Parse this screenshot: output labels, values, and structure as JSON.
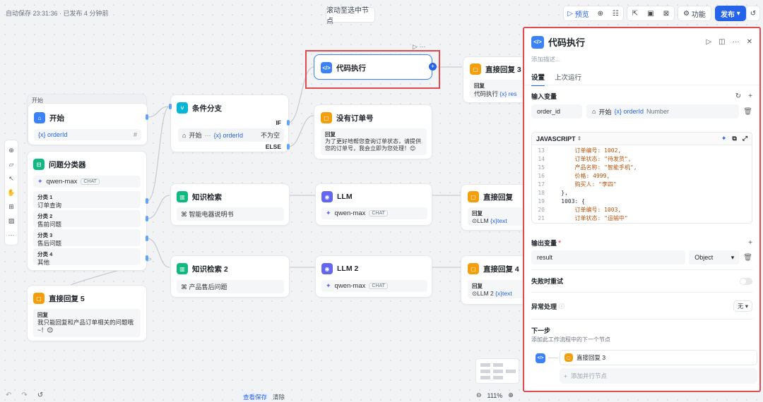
{
  "topbar": {
    "autosave": "自动保存 23:31:36 · 已发布 4 分钟前",
    "scroll_btn": "滚动至选中节点",
    "preview": "预览",
    "features": "功能",
    "publish": "发布"
  },
  "nodes": {
    "start": {
      "group_label": "开始",
      "title": "开始",
      "var": "{x} orderId",
      "hash": "#"
    },
    "classifier": {
      "title": "问题分类器",
      "model": "qwen-max",
      "tag": "CHAT",
      "classes": [
        {
          "label": "分类 1",
          "text": "订单查询"
        },
        {
          "label": "分类 2",
          "text": "售前问题"
        },
        {
          "label": "分类 3",
          "text": "售后问题"
        },
        {
          "label": "分类 4",
          "text": "其他"
        }
      ]
    },
    "reply5": {
      "title": "直接回复 5",
      "label": "回复",
      "text": "我只能回复和产品订单相关的问题哦~！😊"
    },
    "condition": {
      "title": "条件分支",
      "if": "IF",
      "else": "ELSE",
      "start_ref": "开始",
      "dots": "···",
      "var": "{x} orderId",
      "op": "不为空"
    },
    "code": {
      "title": "代码执行"
    },
    "no_order": {
      "title": "没有订单号",
      "label": "回复",
      "text": "为了更好地帮您查询订单状态，请提供您的订单号，我会立即为您处理！😊"
    },
    "reply3": {
      "title": "直接回复 3",
      "label": "回复",
      "ref": "代码执行",
      "var": "{x} res"
    },
    "kb1": {
      "title": "知识检索",
      "item": "智能电器说明书"
    },
    "llm": {
      "title": "LLM",
      "model": "qwen-max",
      "tag": "CHAT"
    },
    "reply_llm": {
      "title": "直接回复",
      "label": "回复",
      "ref": "LLM",
      "var": "{x}text"
    },
    "kb2": {
      "title": "知识检索 2",
      "item": "产品售后问题"
    },
    "llm2": {
      "title": "LLM 2",
      "model": "qwen-max",
      "tag": "CHAT"
    },
    "reply4": {
      "title": "直接回复 4",
      "label": "回复",
      "ref": "LLM 2",
      "var": "{x}text"
    }
  },
  "panel": {
    "title": "代码执行",
    "desc_placeholder": "添加描述...",
    "tabs": [
      "设置",
      "上次运行"
    ],
    "input_vars_label": "输入变量",
    "input_var_name": "order_id",
    "input_var_src": "开始",
    "input_var_ref": "{x} orderId",
    "input_var_type": "Number",
    "lang": "JAVASCRIPT",
    "code_lines": [
      {
        "n": "13",
        "t": "        订单编号: 1002,"
      },
      {
        "n": "14",
        "t": "        订单状态: \"待发货\","
      },
      {
        "n": "15",
        "t": "        产品名称: \"智能手机\","
      },
      {
        "n": "16",
        "t": "        价格: 4999,"
      },
      {
        "n": "17",
        "t": "        购买人: \"李四\""
      },
      {
        "n": "18",
        "t": "    },"
      },
      {
        "n": "19",
        "t": "    1003: {"
      },
      {
        "n": "20",
        "t": "        订单编号: 1003,"
      },
      {
        "n": "21",
        "t": "        订单状态: \"运输中\""
      }
    ],
    "output_vars_label": "输出变量",
    "required_mark": "*",
    "output_name": "result",
    "output_type": "Object",
    "retry_label": "失败时重试",
    "error_label": "异常处理",
    "error_value": "无",
    "next_label": "下一步",
    "next_desc": "添加此工作流程中的下一个节点",
    "next_node": "直接回复 3",
    "add_parallel": "添加并行节点"
  },
  "bottom": {
    "history": "查看保存",
    "clear": "清除",
    "zoom": "111%"
  }
}
